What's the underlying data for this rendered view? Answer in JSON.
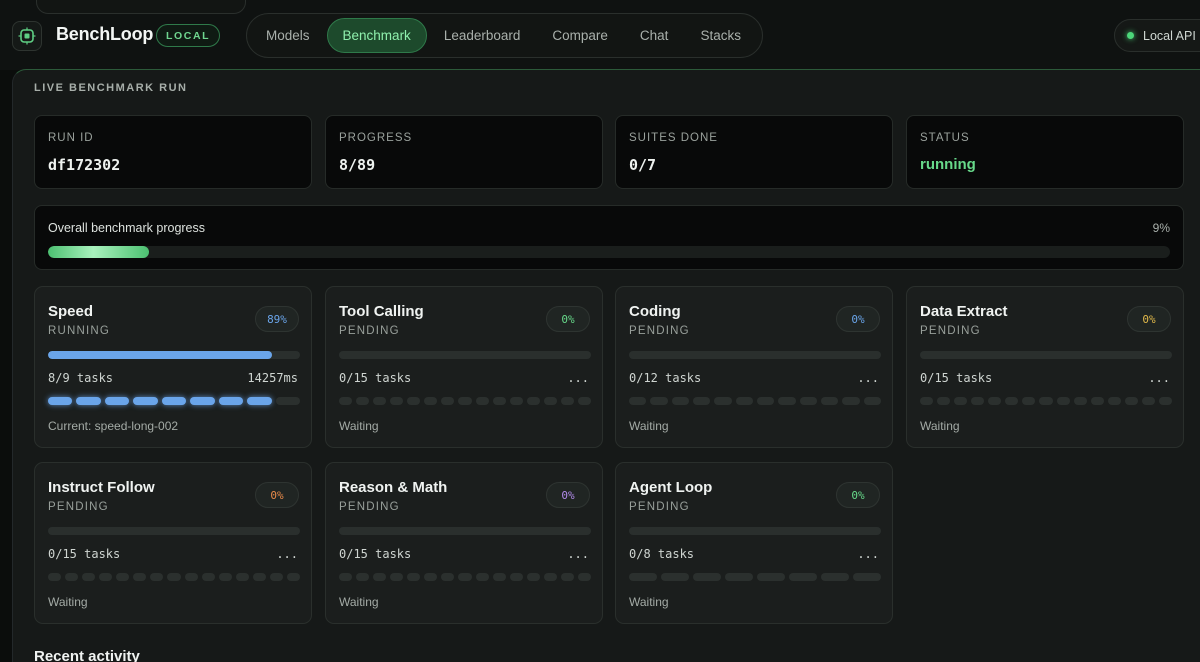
{
  "brand": {
    "name": "BenchLoop",
    "badge": "LOCAL"
  },
  "nav": {
    "tabs": [
      "Models",
      "Benchmark",
      "Leaderboard",
      "Compare",
      "Chat",
      "Stacks"
    ],
    "active": "Benchmark"
  },
  "api": {
    "label": "Local API",
    "status_color": "#4cd67a"
  },
  "run": {
    "section_title": "LIVE BENCHMARK RUN",
    "stats": [
      {
        "label": "RUN ID",
        "value": "df172302"
      },
      {
        "label": "PROGRESS",
        "value": "8/89"
      },
      {
        "label": "SUITES DONE",
        "value": "0/7"
      },
      {
        "label": "STATUS",
        "value": "running"
      }
    ],
    "overall": {
      "label": "Overall benchmark progress",
      "percent_text": "9%",
      "fraction": 0.09
    }
  },
  "suites": [
    {
      "title": "Speed",
      "state": "RUNNING",
      "pct": "89%",
      "pct_color": "#6aa5ea",
      "progress": 0.89,
      "tasks": "8/9 tasks",
      "right": "14257ms",
      "done": 8,
      "total": 9,
      "foot": "Current: speed-long-002"
    },
    {
      "title": "Tool Calling",
      "state": "PENDING",
      "pct": "0%",
      "pct_color": "#67d98a",
      "progress": 0,
      "tasks": "0/15 tasks",
      "right": "...",
      "done": 0,
      "total": 15,
      "foot": "Waiting"
    },
    {
      "title": "Coding",
      "state": "PENDING",
      "pct": "0%",
      "pct_color": "#6aa5ea",
      "progress": 0,
      "tasks": "0/12 tasks",
      "right": "...",
      "done": 0,
      "total": 12,
      "foot": "Waiting"
    },
    {
      "title": "Data Extract",
      "state": "PENDING",
      "pct": "0%",
      "pct_color": "#e0b84a",
      "progress": 0,
      "tasks": "0/15 tasks",
      "right": "...",
      "done": 0,
      "total": 15,
      "foot": "Waiting"
    },
    {
      "title": "Instruct Follow",
      "state": "PENDING",
      "pct": "0%",
      "pct_color": "#e88a4a",
      "progress": 0,
      "tasks": "0/15 tasks",
      "right": "...",
      "done": 0,
      "total": 15,
      "foot": "Waiting"
    },
    {
      "title": "Reason & Math",
      "state": "PENDING",
      "pct": "0%",
      "pct_color": "#b08ae8",
      "progress": 0,
      "tasks": "0/15 tasks",
      "right": "...",
      "done": 0,
      "total": 15,
      "foot": "Waiting"
    },
    {
      "title": "Agent Loop",
      "state": "PENDING",
      "pct": "0%",
      "pct_color": "#67d98a",
      "progress": 0,
      "tasks": "0/8 tasks",
      "right": "...",
      "done": 0,
      "total": 8,
      "foot": "Waiting"
    }
  ],
  "recent": {
    "title": "Recent activity"
  }
}
